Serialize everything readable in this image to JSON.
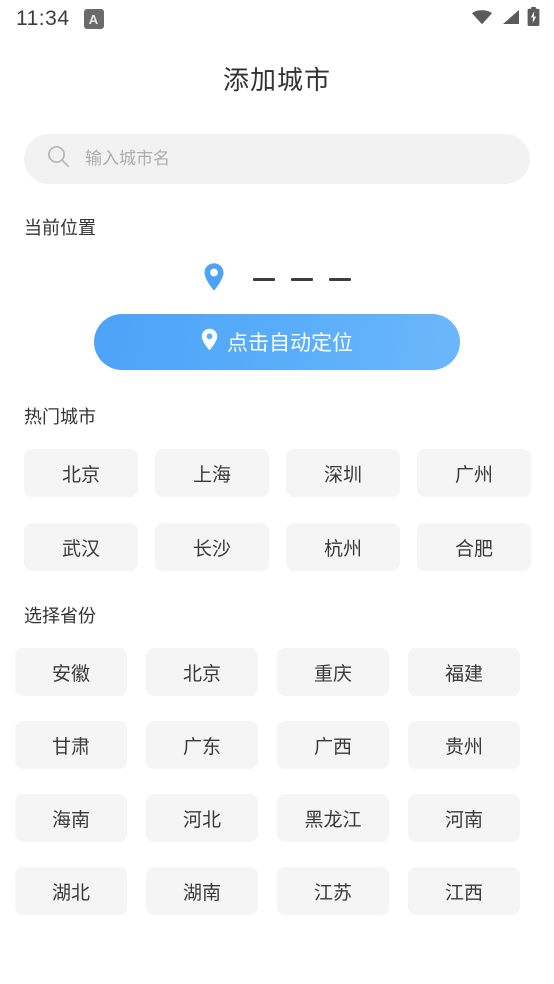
{
  "statusbar": {
    "time": "11:34",
    "app_badge_letter": "A",
    "icons": [
      "wifi-icon",
      "cellular-signal-icon",
      "battery-charging-icon"
    ]
  },
  "header": {
    "title": "添加城市"
  },
  "search": {
    "placeholder": "输入城市名",
    "value": "",
    "icon": "search-icon"
  },
  "current_location": {
    "section_title": "当前位置",
    "pin_icon": "location-pin-icon",
    "value": "— — —",
    "locate_button": {
      "label": "点击自动定位",
      "icon": "location-pin-icon"
    }
  },
  "hot_cities": {
    "section_title": "热门城市",
    "items": [
      "北京",
      "上海",
      "深圳",
      "广州",
      "武汉",
      "长沙",
      "杭州",
      "合肥"
    ]
  },
  "provinces": {
    "section_title": "选择省份",
    "items": [
      "安徽",
      "北京",
      "重庆",
      "福建",
      "甘肃",
      "广东",
      "广西",
      "贵州",
      "海南",
      "河北",
      "黑龙江",
      "河南",
      "湖北",
      "湖南",
      "江苏",
      "江西"
    ]
  },
  "colors": {
    "accent": "#4ca3f8",
    "accent_end": "#6cb7fa",
    "chip_bg": "#f5f5f5",
    "search_bg": "#f2f2f2",
    "text": "#333333",
    "placeholder": "#adadad"
  }
}
